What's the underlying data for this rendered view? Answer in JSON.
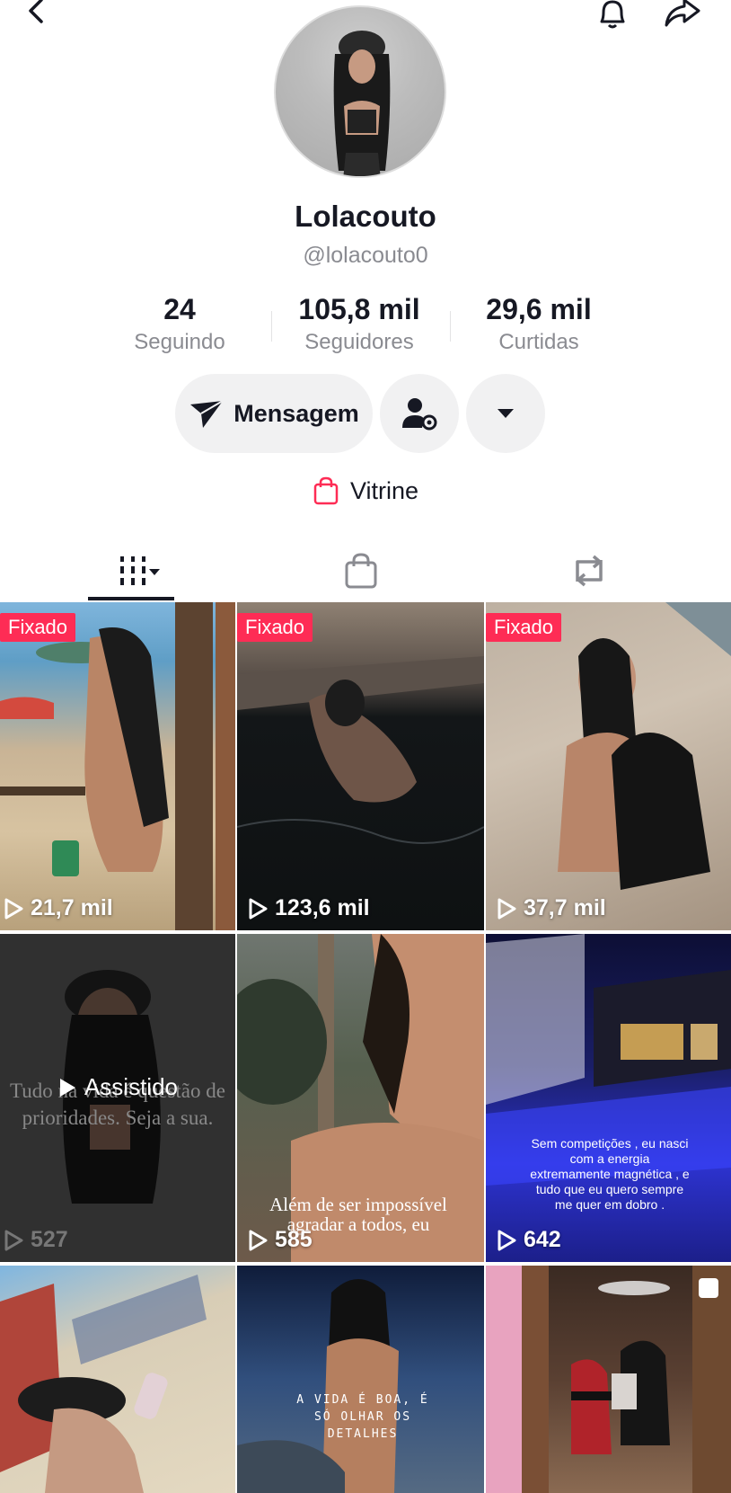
{
  "profile": {
    "name": "Lolacouto",
    "handle": "@lolacouto0"
  },
  "stats": [
    {
      "value": "24",
      "label": "Seguindo"
    },
    {
      "value": "105,8 mil",
      "label": "Seguidores"
    },
    {
      "value": "29,6 mil",
      "label": "Curtidas"
    }
  ],
  "actions": {
    "message_label": "Mensagem"
  },
  "vitrine": {
    "label": "Vitrine"
  },
  "tabs": [
    "videos-grid-icon",
    "shop-bag-icon",
    "repost-icon"
  ],
  "videos": [
    {
      "pinned": "Fixado",
      "views": "21,7 mil"
    },
    {
      "pinned": "Fixado",
      "views": "123,6 mil"
    },
    {
      "pinned": "Fixado",
      "views": "37,7 mil"
    },
    {
      "watched": "Assistido",
      "views": "527",
      "caption": "Tudo na vida é questão de prioridades. Seja a sua."
    },
    {
      "views": "585",
      "caption": "Além de ser impossível agradar a todos, eu"
    },
    {
      "views": "642",
      "caption": "Sem competições , eu nasci com a energia extremamente magnética , e tudo que eu quero sempre me quer em dobro ."
    },
    {},
    {
      "caption": "A VIDA É BOA, É SÓ OLHAR OS DETALHES"
    },
    {}
  ],
  "colors": {
    "accent": "#fe2c55",
    "text": "#161823",
    "muted": "#8a8b91",
    "button_bg": "#f1f1f2"
  }
}
